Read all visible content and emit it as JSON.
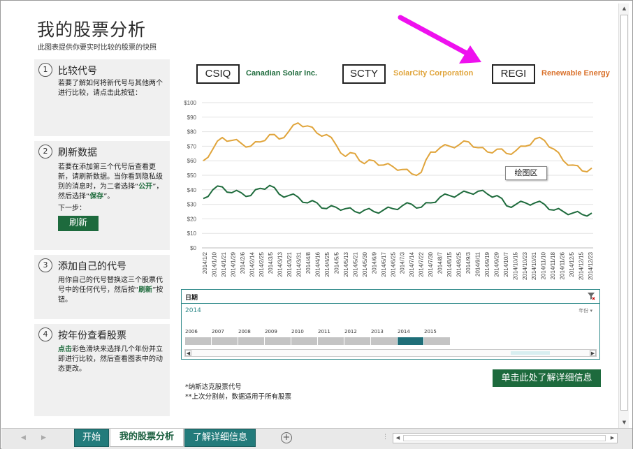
{
  "header": {
    "title": "我的股票分析",
    "subtitle": "此图表提供你要实时比较的股票的快照"
  },
  "steps": [
    {
      "num": "1",
      "title": "比较代号",
      "body": "若要了解如何将新代号与其他两个进行比较，请点击此按钮："
    },
    {
      "num": "2",
      "title": "刷新数据",
      "body_pre": "若要在添加第三个代号后查看更新，请刷新数据。当你看到隐私级别的消息时，为二者选择“",
      "body_hl1": "公开",
      "body_mid": "”，然后选择“",
      "body_hl2": "保存",
      "body_post": "”。",
      "next": "下一步：",
      "button": "刷新"
    },
    {
      "num": "3",
      "title": "添加自己的代号",
      "body_pre": "用你自己的代号替换这三个股票代号中的任何代号，然后按“",
      "body_hl": "刷新",
      "body_post": "”按钮。"
    },
    {
      "num": "4",
      "title": "按年份查看股票",
      "body_hl": "点击",
      "body_post": "彩色滑块来选择几个年份并立即进行比较，然后查看图表中的动态更改。"
    }
  ],
  "tickers": [
    {
      "symbol": "CSIQ",
      "name": "Canadian Solar Inc.",
      "color": "#1e6b3c"
    },
    {
      "symbol": "SCTY",
      "name": "SolarCity Corporation",
      "color": "#e0a43a"
    },
    {
      "symbol": "REGI",
      "name": "Renewable Energy",
      "color": "#d9702a"
    }
  ],
  "plot_area_label": "绘图区",
  "chart_data": {
    "type": "line",
    "ylim": [
      0,
      100
    ],
    "y_tick_labels": [
      "$0",
      "$10",
      "$20",
      "$30",
      "$40",
      "$50",
      "$60",
      "$70",
      "$80",
      "$90",
      "$100"
    ],
    "x_tick_labels": [
      "2014/1/2",
      "2014/1/10",
      "2014/1/21",
      "2014/1/29",
      "2014/2/6",
      "2014/2/14",
      "2014/2/25",
      "2014/3/5",
      "2014/3/13",
      "2014/3/21",
      "2014/3/31",
      "2014/4/8",
      "2014/4/16",
      "2014/4/25",
      "2014/5/5",
      "2014/5/13",
      "2014/5/21",
      "2014/5/30",
      "2014/6/9",
      "2014/6/17",
      "2014/6/25",
      "2014/7/3",
      "2014/7/14",
      "2014/7/22",
      "2014/7/30",
      "2014/8/7",
      "2014/8/15",
      "2014/8/25",
      "2014/9/3",
      "2014/9/11",
      "2014/9/19",
      "2014/9/29",
      "2014/10/7",
      "2014/10/15",
      "2014/10/23",
      "2014/10/31",
      "2014/11/10",
      "2014/11/18",
      "2014/11/26",
      "2014/12/5",
      "2014/12/15",
      "2014/12/23"
    ],
    "series": [
      {
        "name": "SCTY",
        "color": "#e0a43a",
        "values": [
          60,
          68,
          76,
          74,
          72,
          70,
          73,
          78,
          75,
          80,
          86,
          84,
          79,
          78,
          71,
          63,
          65,
          58,
          60,
          57,
          56,
          54,
          51,
          52,
          66,
          69,
          70,
          71,
          73,
          69,
          66,
          68,
          65,
          67,
          70,
          75,
          74,
          68,
          60,
          57,
          53,
          55
        ]
      },
      {
        "name": "CSIQ",
        "color": "#1e6b3c",
        "values": [
          34,
          40,
          42,
          38,
          38,
          36,
          41,
          43,
          37,
          36,
          35,
          31,
          31,
          27,
          28,
          27,
          25,
          26,
          25,
          26,
          27,
          29,
          30,
          28,
          31,
          35,
          36,
          37,
          38,
          39,
          37,
          36,
          29,
          30,
          31,
          31,
          30,
          26,
          25,
          24,
          23,
          24
        ]
      }
    ]
  },
  "timeline": {
    "title": "日期",
    "selected": "2014",
    "level": "年份",
    "years": [
      "2006",
      "2007",
      "2008",
      "2009",
      "2010",
      "2011",
      "2012",
      "2013",
      "2014",
      "2015"
    ],
    "selected_index": 8
  },
  "details_button": "单击此处了解详细信息",
  "footnotes": [
    "*纳斯达克股票代号",
    "**上次分割前，数据适用于所有股票"
  ],
  "sheets": [
    {
      "label": "开始",
      "state": "green"
    },
    {
      "label": "我的股票分析",
      "state": "active"
    },
    {
      "label": "了解详细信息",
      "state": "green"
    }
  ],
  "tab_nav": {
    "prev": "◀",
    "next": "▶",
    "dots": "⋮"
  },
  "scroll_arrows": {
    "up": "▲",
    "down": "▼",
    "left": "◀",
    "right": "▶"
  }
}
